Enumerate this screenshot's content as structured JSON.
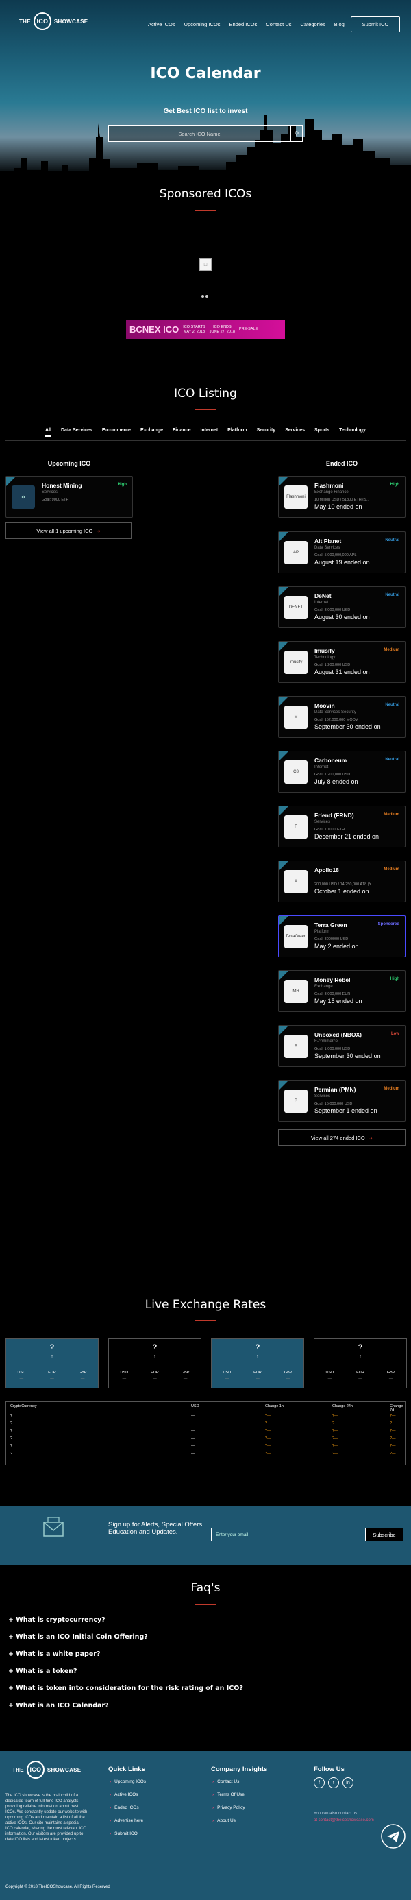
{
  "header": {
    "logo": {
      "the": "THE",
      "ico": "ICO",
      "showcase": "SHOWCASE"
    },
    "nav": [
      "Active ICOs",
      "Upcoming ICOs",
      "Ended ICOs",
      "Contact Us",
      "Categories",
      "Blog"
    ],
    "submit_label": "Submit ICO"
  },
  "hero": {
    "title": "ICO Calendar",
    "subtitle": "Get Best ICO list to invest",
    "search_placeholder": "Search ICO Name"
  },
  "sponsored": {
    "title": "Sponsored ICOs",
    "banner": {
      "brand": "BCNEX ICO",
      "pre_label": "PRE-SALE",
      "ico_start": "ICO STARTS",
      "ico_start_date": "MAY 2, 2018",
      "ico_end": "ICO ENDS",
      "ico_end_date": "JUNE 27, 2018"
    }
  },
  "listing": {
    "title": "ICO Listing",
    "tabs": [
      "All",
      "Data Services",
      "E-commerce",
      "Exchange",
      "Finance",
      "Internet",
      "Platform",
      "Security",
      "Services",
      "Sports",
      "Technology"
    ],
    "upcoming_title": "Upcoming ICO",
    "ended_title": "Ended ICO",
    "upcoming": [
      {
        "name": "Honest Mining",
        "category": "Services",
        "goal": "Goal: 9000 ETH",
        "rating": "High",
        "rating_color": "#2ecc71"
      }
    ],
    "upcoming_view_all": "View all 1 upcoming ICO",
    "ended": [
      {
        "name": "Flashmoni",
        "category": "Exchange Finance",
        "goal": "10 Million USD / 51300 ETH (S...",
        "date": "May 10 ended on",
        "rating": "High",
        "rating_color": "#2ecc71",
        "logo": "Flashmoni"
      },
      {
        "name": "Alt Planet",
        "category": "Data Services",
        "goal": "Goal: 5,000,000,000 APL",
        "date": "August 19 ended on",
        "rating": "Neutral",
        "rating_color": "#3498db",
        "logo": "AP"
      },
      {
        "name": "DeNet",
        "category": "Internet",
        "goal": "Goal: 3,000,000 USD",
        "date": "August 30 ended on",
        "rating": "Neutral",
        "rating_color": "#3498db",
        "logo": "DENET"
      },
      {
        "name": "Imusify",
        "category": "Technology",
        "goal": "Goal: 1,200,000 USD",
        "date": "August 31 ended on",
        "rating": "Medium",
        "rating_color": "#e67e22",
        "logo": "imusify"
      },
      {
        "name": "Moovin",
        "category": "Data Services Security",
        "goal": "Goal: 152,000,000 MOOV",
        "date": "September 30 ended on",
        "rating": "Neutral",
        "rating_color": "#3498db",
        "logo": "M"
      },
      {
        "name": "Carboneum",
        "category": "Internet",
        "goal": "Goal: 1,200,000 USD",
        "date": "July 8 ended on",
        "rating": "Neutral",
        "rating_color": "#3498db",
        "logo": "C8"
      },
      {
        "name": "Friend (FRND)",
        "category": "Services",
        "goal": "Goal: 10 000 ETH",
        "date": "December 21 ended on",
        "rating": "Medium",
        "rating_color": "#e67e22",
        "logo": "F"
      },
      {
        "name": "Apollo18",
        "category": "",
        "goal": "200,000 USD / 14,250,000 A18 (Y...",
        "date": "October 1 ended on",
        "rating": "Medium",
        "rating_color": "#e67e22",
        "logo": "A"
      },
      {
        "name": "Terra Green",
        "category": "Platform",
        "goal": "Goal: 3000000 USD",
        "date": "May 2 ended on",
        "rating": "Sponsored",
        "rating_color": "#6c6cff",
        "logo": "TerraGreen"
      },
      {
        "name": "Money Rebel",
        "category": "Exchange",
        "goal": "Goal: 3,000,000 EUR",
        "date": "May 15 ended on",
        "rating": "High",
        "rating_color": "#2ecc71",
        "logo": "MR"
      },
      {
        "name": "Unboxed (NBOX)",
        "category": "E-commerce",
        "goal": "Goal: 1,000,000 USD",
        "date": "September 30 ended on",
        "rating": "Low",
        "rating_color": "#e74c3c",
        "logo": "X"
      },
      {
        "name": "Permian (PMN)",
        "category": "Services",
        "goal": "Goal: 15,000,000 USD",
        "date": "September 1 ended on",
        "rating": "Medium",
        "rating_color": "#e67e22",
        "logo": "P"
      }
    ],
    "ended_view_all": "View all 274 ended ICO"
  },
  "exchange": {
    "title": "Live Exchange Rates",
    "cards": [
      {
        "symbol": "?",
        "arrow": "↑",
        "labels": [
          "USD",
          "EUR",
          "GBP"
        ],
        "values": [
          "—",
          "—",
          "—"
        ],
        "bg": "#1e5670"
      },
      {
        "symbol": "?",
        "arrow": "↑",
        "labels": [
          "USD",
          "EUR",
          "GBP"
        ],
        "values": [
          "—",
          "—",
          "—"
        ],
        "bg": "#000"
      },
      {
        "symbol": "?",
        "arrow": "↑",
        "labels": [
          "USD",
          "EUR",
          "GBP"
        ],
        "values": [
          "—",
          "—",
          "—"
        ],
        "bg": "#1e5670"
      },
      {
        "symbol": "?",
        "arrow": "↑",
        "labels": [
          "USD",
          "EUR",
          "GBP"
        ],
        "values": [
          "—",
          "—",
          "—"
        ],
        "bg": "#000"
      }
    ],
    "table": {
      "headers": [
        "CryptoCurrency",
        "USD",
        "Change 1h",
        "Change 24h",
        "Change 7d"
      ],
      "rows": [
        [
          "?",
          "—",
          "?—",
          "?—",
          "?—"
        ],
        [
          "?",
          "—",
          "?—",
          "?—",
          "?—"
        ],
        [
          "?",
          "—",
          "?—",
          "?—",
          "?—"
        ],
        [
          "?",
          "—",
          "?—",
          "?—",
          "?—"
        ],
        [
          "?",
          "—",
          "?—",
          "?—",
          "?—"
        ],
        [
          "?",
          "—",
          "?—",
          "?—",
          "?—"
        ]
      ]
    }
  },
  "alert": {
    "text": "Sign up for Alerts, Special Offers, Education and Updates.",
    "email_placeholder": "Enter your email",
    "subscribe_label": "Subscribe"
  },
  "faq": {
    "title": "Faq's",
    "items": [
      "What is cryptocurrency?",
      "What is an ICO Initial Coin Offering?",
      "What is a white paper?",
      "What is a token?",
      "What is token into consideration for the risk rating of an ICO?",
      "What is an ICO Calendar?"
    ]
  },
  "footer": {
    "about": "The ICO showcase is the brainchild of a dedicated team of full-time ICO analysts providing reliable information about best ICOs. We constantly update our website with upcoming ICOs and maintain a list of all the active ICOs. Our site maintains a special ICO calendar, sharing the most relevant ICO information. Our visitors are provided up to date ICO lists and latest token projects.",
    "quick_title": "Quick Links",
    "quick": [
      "Upcoming ICOs",
      "Active ICOs",
      "Ended ICOs",
      "Advertise here",
      "Submit ICO"
    ],
    "insights_title": "Company Insights",
    "insights": [
      "Contact Us",
      "Terms Of Use",
      "Privacy Policy",
      "About Us"
    ],
    "follow_title": "Follow Us",
    "contact_line": "You can also contact us",
    "contact_email": "at contact@theicoshowcase.com",
    "copyright": "Copyright © 2018 TheICOShowcase. All Rights Reserved"
  }
}
